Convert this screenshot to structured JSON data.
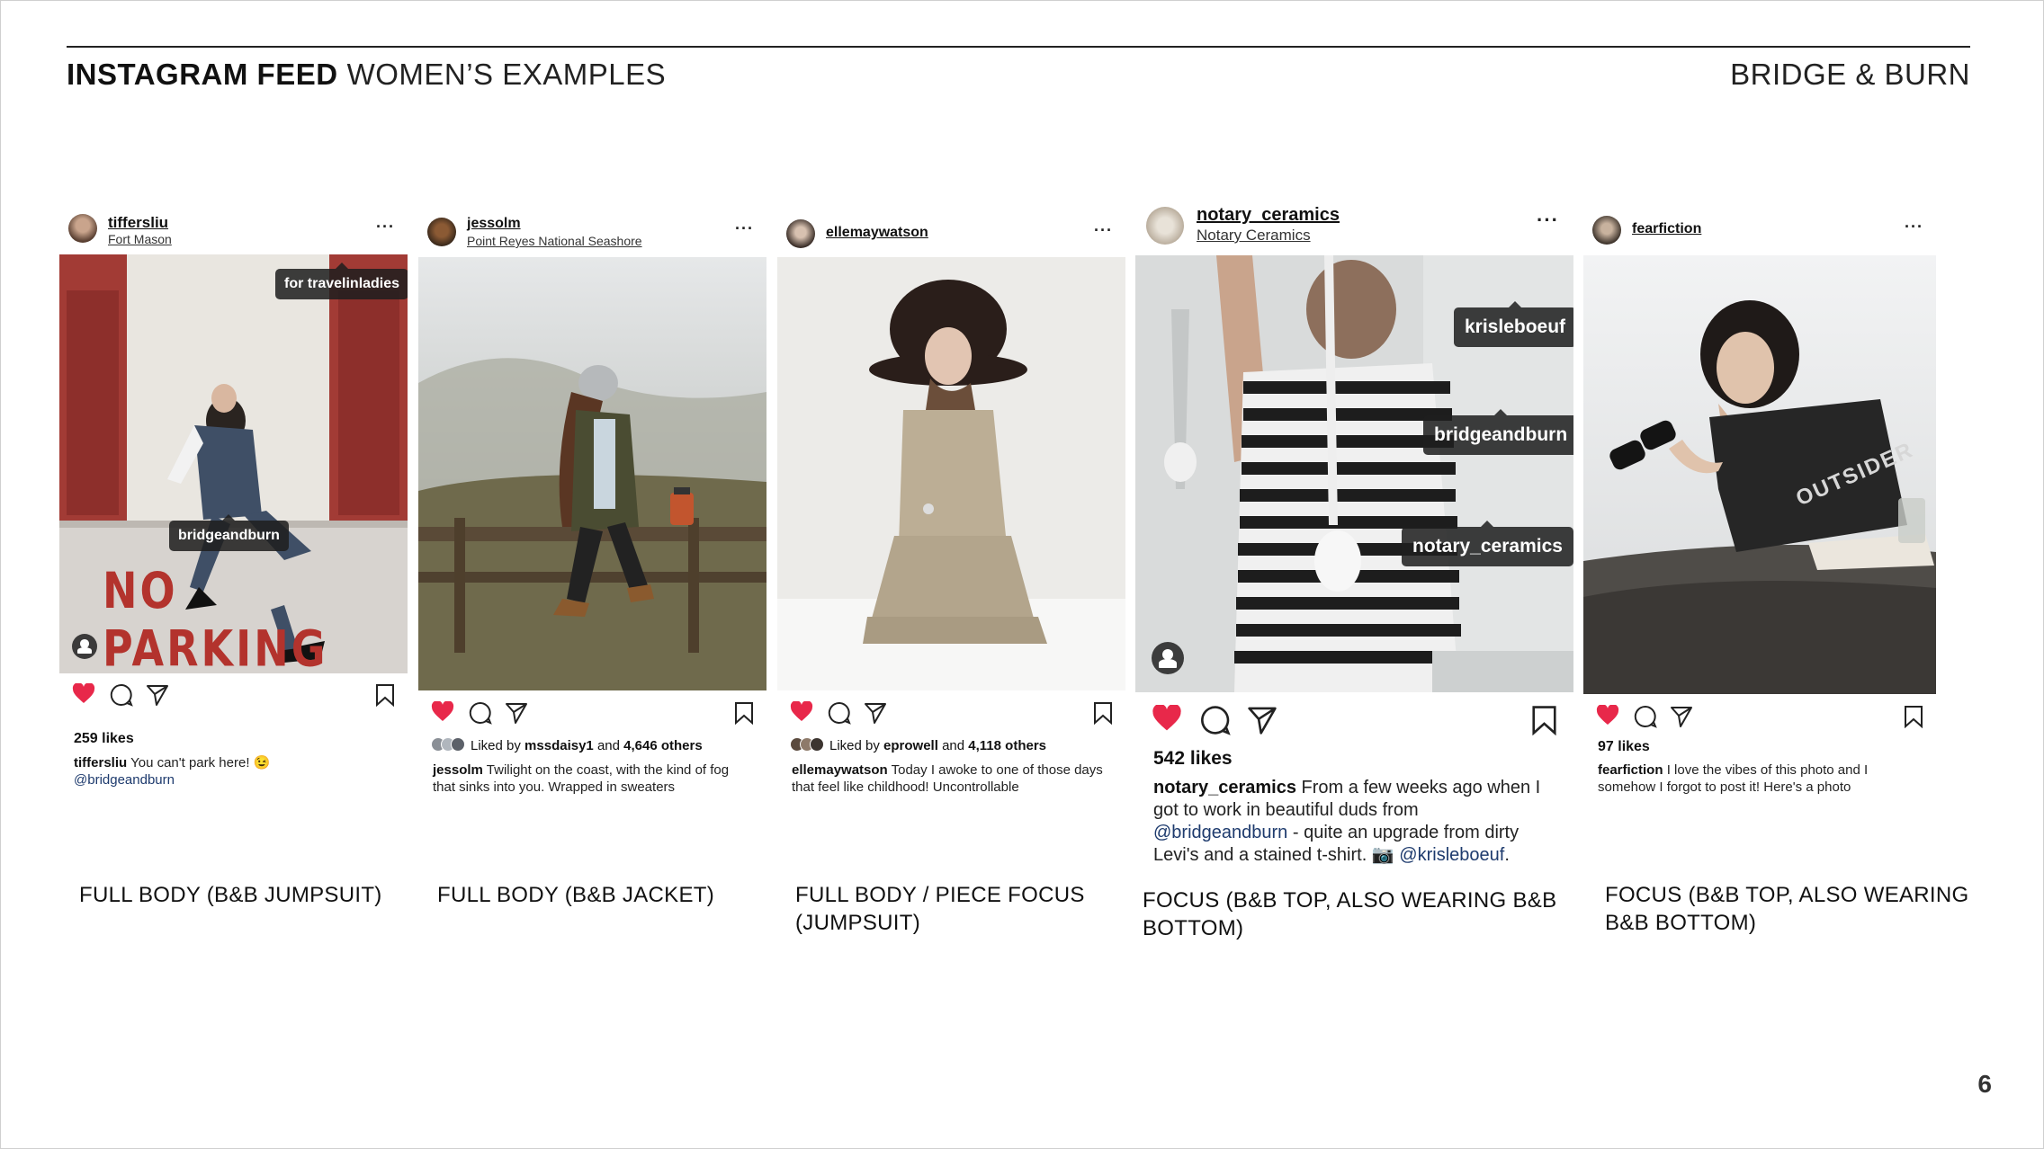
{
  "header": {
    "title_bold": "INSTAGRAM FEED",
    "title_light": "WOMEN’S EXAMPLES",
    "brand": "BRIDGE & BURN"
  },
  "page_number": "6",
  "posts": [
    {
      "username": "tiffersliu",
      "location": "Fort Mason",
      "more": "···",
      "tags": [
        "for travelinladies",
        "bridgeandburn"
      ],
      "likes": "259 likes",
      "caption_user": "tiffersliu",
      "caption_text": "You can't park here! 😉",
      "caption_mention": "@bridgeandburn",
      "sign_text": "NO PARKING",
      "label": "FULL BODY (B&B JUMPSUIT)"
    },
    {
      "username": "jessolm",
      "location": "Point Reyes National Seashore",
      "more": "···",
      "liked_by_prefix": "Liked by",
      "liked_by_user": "mssdaisy1",
      "liked_by_and": "and",
      "liked_by_others": "4,646 others",
      "caption_user": "jessolm",
      "caption_text": "Twilight on the coast, with the kind of fog that sinks into you. Wrapped in sweaters",
      "label": "FULL BODY (B&B JACKET)"
    },
    {
      "username": "ellemaywatson",
      "more": "···",
      "liked_by_prefix": "Liked by",
      "liked_by_user": "eprowell",
      "liked_by_and": "and",
      "liked_by_others": "4,118 others",
      "caption_user": "ellemaywatson",
      "caption_text": "Today I awoke to one of those days that feel like childhood! Uncontrollable",
      "label_line1": "FULL BODY / PIECE FOCUS",
      "label_line2": "(JUMPSUIT)"
    },
    {
      "username": "notary_ceramics",
      "location": "Notary Ceramics",
      "more": "···",
      "tags": [
        "krisleboeuf",
        "bridgeandburn",
        "notary_ceramics"
      ],
      "likes": "542 likes",
      "caption_user": "notary_ceramics",
      "caption_text_1": "From a few weeks ago when I got to work in beautiful duds from",
      "caption_mention_1": "@bridgeandburn",
      "caption_text_2": "- quite an upgrade from dirty Levi's and a stained t-shirt. 📷",
      "caption_mention_2": "@krisleboeuf",
      "caption_end": ".",
      "label_line1": "FOCUS (B&B TOP, ALSO WEARING B&B",
      "label_line2": "BOTTOM)"
    },
    {
      "username": "fearfiction",
      "more": "···",
      "likes": "97 likes",
      "caption_user": "fearfiction",
      "caption_text": "I love the vibes of this photo and I somehow I forgot to post it! Here's a photo",
      "shirt_text": "OUTSIDER",
      "label_line1": "FOCUS (B&B TOP, ALSO WEARING",
      "label_line2": "B&B BOTTOM)"
    }
  ],
  "colors": {
    "heart": "#e8284a",
    "mention": "#1d3a6d",
    "tag_bg": "#1e1e1e"
  }
}
